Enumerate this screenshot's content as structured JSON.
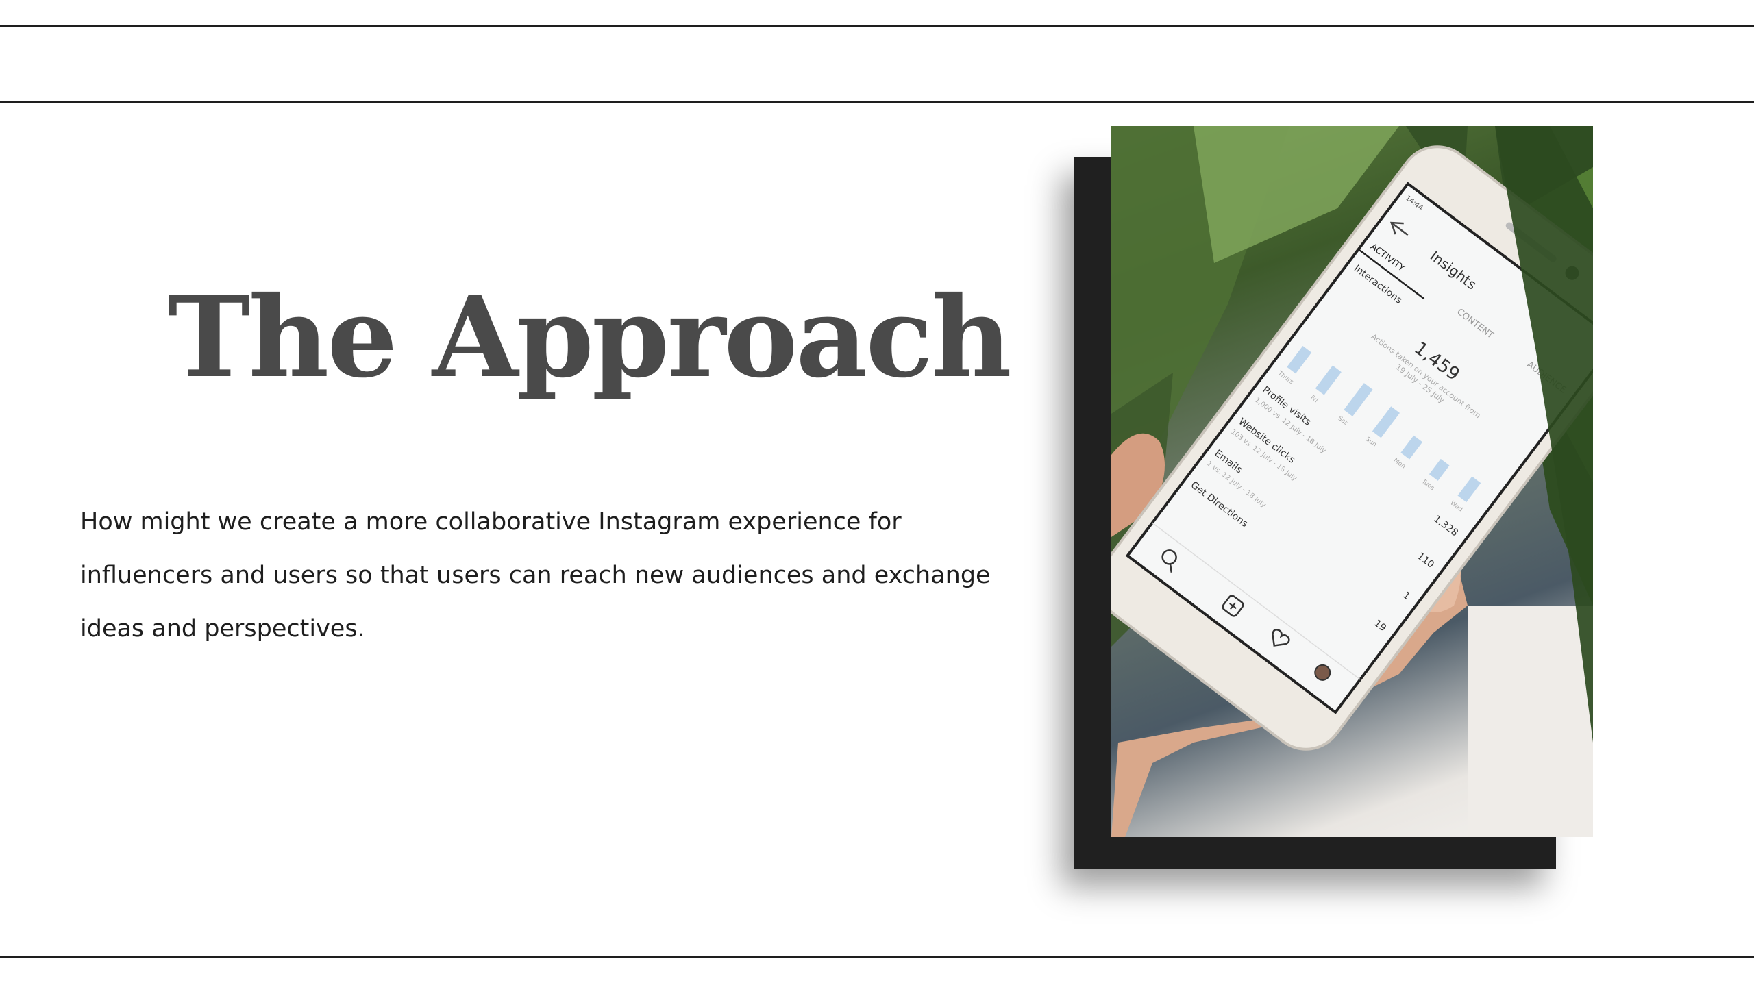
{
  "slide": {
    "title": "The Approach",
    "body": "How might we create a more collaborative Instagram experience for influencers and users so that users can reach new audiences and exchange ideas and perspectives."
  },
  "phone_screen": {
    "time": "14:44",
    "header": "Insights",
    "tabs": [
      "ACTIVITY",
      "CONTENT",
      "AUDIENCE"
    ],
    "section": "Interactions",
    "total": "1,459",
    "total_caption": "Actions taken on your account from",
    "total_range": "19 July - 25 July",
    "bar_days": [
      "Thurs",
      "Fri",
      "Sat",
      "Sun",
      "Mon",
      "Tues",
      "Wed"
    ],
    "bar_levels": [
      0.55,
      0.6,
      0.7,
      0.65,
      0.45,
      0.4,
      0.5
    ],
    "rows": [
      {
        "label": "Profile visits",
        "sub": "1,000 vs. 12 July - 18 July",
        "value": "1,328"
      },
      {
        "label": "Website clicks",
        "sub": "103 vs. 12 July - 18 July",
        "value": "110"
      },
      {
        "label": "Emails",
        "sub": "1 vs. 12 July - 18 July",
        "value": "1"
      },
      {
        "label": "Get Directions",
        "sub": "",
        "value": "19"
      }
    ]
  },
  "colors": {
    "rule": "#1e1e1e",
    "title": "#4a4a4a",
    "body": "#1e1e1e",
    "frame": "#202020",
    "bar": "#bcd5ec"
  },
  "icons": [
    "back-arrow-icon",
    "search-icon",
    "add-icon",
    "heart-icon",
    "profile-icon"
  ]
}
